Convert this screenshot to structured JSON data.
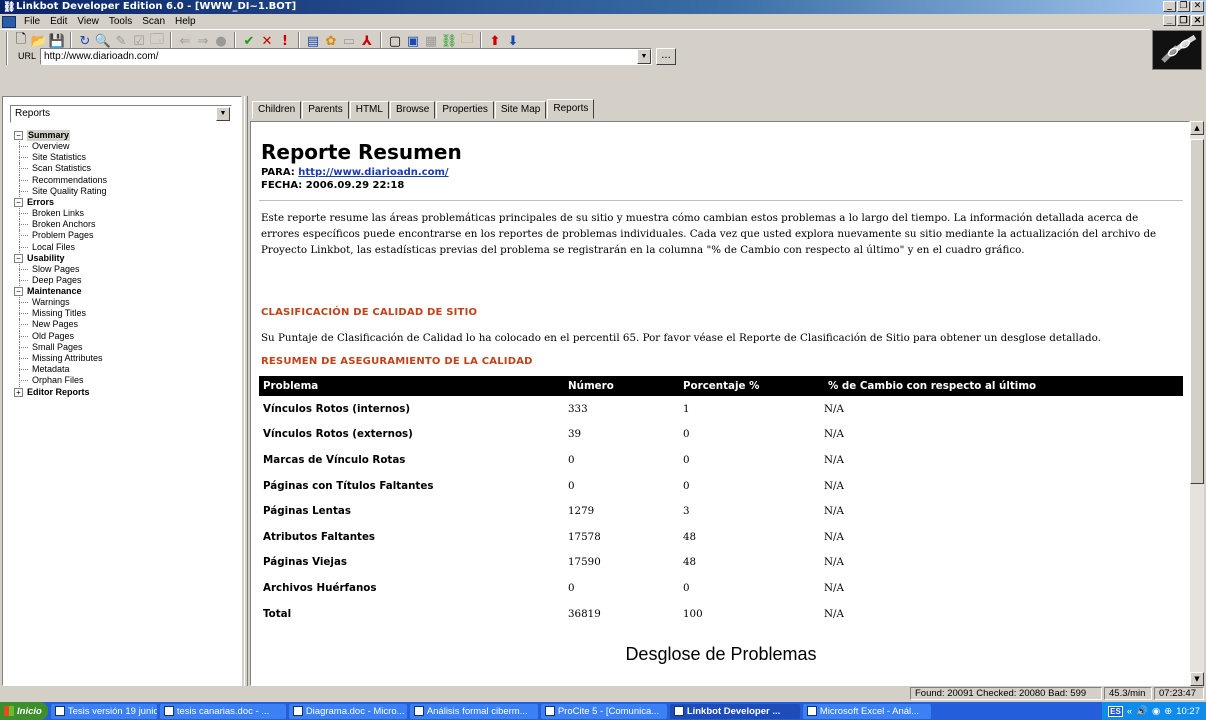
{
  "window": {
    "title": "Linkbot Developer Edition 6.0 - [WWW_DI~1.BOT]"
  },
  "menu": [
    "File",
    "Edit",
    "View",
    "Tools",
    "Scan",
    "Help"
  ],
  "url_bar": {
    "label": "URL",
    "value": "http://www.diarioadn.com/",
    "more_label": "..."
  },
  "left_panel": {
    "selector_value": "Reports",
    "tree": [
      {
        "label": "Summary",
        "expander": "−",
        "selected": true,
        "items": [
          "Overview",
          "Site Statistics",
          "Scan Statistics",
          "Recommendations",
          "Site Quality Rating"
        ]
      },
      {
        "label": "Errors",
        "expander": "−",
        "items": [
          "Broken Links",
          "Broken Anchors",
          "Problem Pages",
          "Local Files"
        ]
      },
      {
        "label": "Usability",
        "expander": "−",
        "items": [
          "Slow Pages",
          "Deep Pages"
        ]
      },
      {
        "label": "Maintenance",
        "expander": "−",
        "items": [
          "Warnings",
          "Missing Titles",
          "New Pages",
          "Old Pages",
          "Small Pages",
          "Missing Attributes",
          "Metadata",
          "Orphan Files"
        ]
      },
      {
        "label": "Editor Reports",
        "expander": "+",
        "items": []
      }
    ]
  },
  "tabs": [
    "Children",
    "Parents",
    "HTML",
    "Browse",
    "Properties",
    "Site Map",
    "Reports"
  ],
  "active_tab": "Reports",
  "report": {
    "title": "Reporte Resumen",
    "para_label": "PARA:",
    "para_link": "http://www.diarioadn.com/",
    "fecha": "FECHA: 2006.09.29 22:18",
    "intro": "Este reporte resume las áreas problemáticas principales de su sitio y muestra cómo cambian estos problemas a lo largo del tiempo. La información detallada acerca de errores específicos puede encontrarse en los reportes de problemas individuales. Cada vez que usted explora nuevamente su sitio mediante la actualización del archivo de Proyecto Linkbot, las estadísticas previas del problema se registrarán en la columna \"% de Cambio con respecto al último\" y en el cuadro gráfico.",
    "quality_heading": "CLASIFICACIÓN DE CALIDAD DE SITIO",
    "quality_text": "Su Puntaje de Clasificación de Calidad lo ha colocado en el percentil 65. Por favor véase el Reporte de Clasificación de Sitio para obtener un desglose detallado.",
    "summary_heading": "RESUMEN DE ASEGURAMIENTO DE LA CALIDAD",
    "table": {
      "headers": [
        "Problema",
        "Número",
        "Porcentaje %",
        "% de Cambio con respecto al último"
      ],
      "rows": [
        [
          "Vínculos Rotos (internos)",
          "333",
          "1",
          "N/A"
        ],
        [
          "Vínculos Rotos (externos)",
          "39",
          "0",
          "N/A"
        ],
        [
          "Marcas de Vínculo Rotas",
          "0",
          "0",
          "N/A"
        ],
        [
          "Páginas con Títulos Faltantes",
          "0",
          "0",
          "N/A"
        ],
        [
          "Páginas Lentas",
          "1279",
          "3",
          "N/A"
        ],
        [
          "Atributos Faltantes",
          "17578",
          "48",
          "N/A"
        ],
        [
          "Páginas Viejas",
          "17590",
          "48",
          "N/A"
        ],
        [
          "Archivos Huérfanos",
          "0",
          "0",
          "N/A"
        ],
        [
          "Total",
          "36819",
          "100",
          "N/A"
        ]
      ]
    },
    "breakdown_title": "Desglose de Problemas"
  },
  "status": {
    "counts": "Found: 20091 Checked: 20080 Bad: 599",
    "rate": "45.3/min",
    "elapsed": "07:23:47"
  },
  "taskbar": {
    "start": "Inicio",
    "tasks": [
      {
        "label": "Tesis versión 19 junio...",
        "active": false
      },
      {
        "label": "tesis canarias.doc - ...",
        "active": false
      },
      {
        "label": "Diagrama.doc - Micro...",
        "active": false
      },
      {
        "label": "Análisis formal ciberm...",
        "active": false
      },
      {
        "label": "ProCite 5 - [Comunica...",
        "active": false
      },
      {
        "label": "Linkbot Developer ...",
        "active": true
      },
      {
        "label": "Microsoft Excel - Anál...",
        "active": false
      }
    ],
    "lang": "ES",
    "clock": "10:27"
  }
}
